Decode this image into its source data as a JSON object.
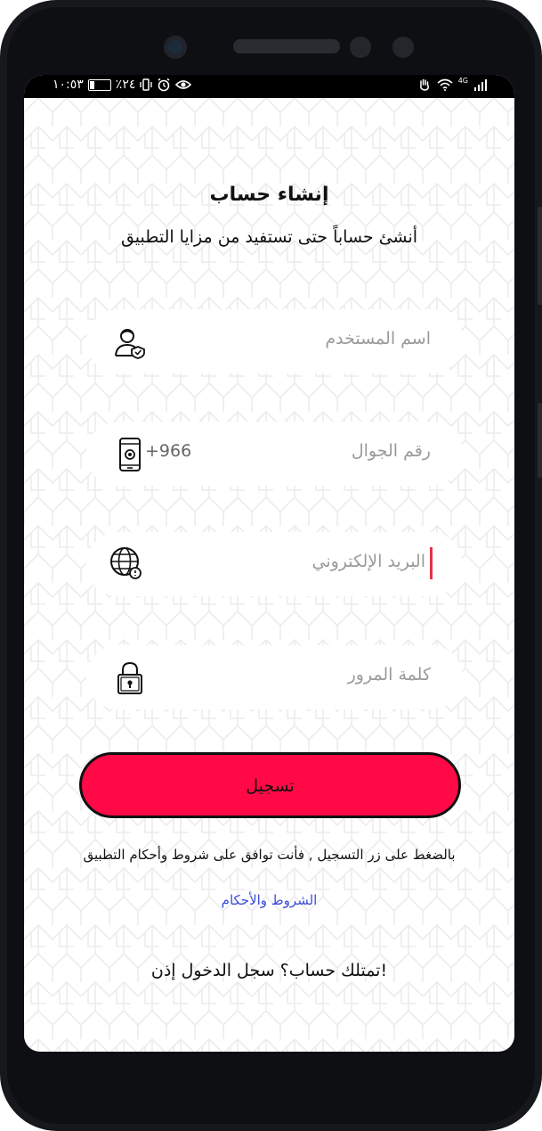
{
  "status_bar": {
    "time": "١٠:٥٣",
    "battery_percent_label": "٪٢٤",
    "battery_level": 0.24,
    "network_label": "4G",
    "icons": [
      "battery-icon",
      "vibrate-icon",
      "alarm-icon",
      "eye-icon",
      "hand-icon",
      "wifi-icon",
      "signal-icon"
    ]
  },
  "header": {
    "title": "إنشاء حساب",
    "subtitle": "أنشئ حساباً حتى تستفيد من مزايا التطبيق"
  },
  "form": {
    "username": {
      "placeholder": "اسم المستخدم",
      "icon": "user-shield-icon"
    },
    "phone": {
      "placeholder": "رقم الجوال",
      "prefix": "+966",
      "icon": "smartphone-icon"
    },
    "email": {
      "placeholder": "البريد الإلكتروني",
      "icon": "globe-icon",
      "focused": true
    },
    "password": {
      "placeholder": "كلمة المرور",
      "icon": "padlock-icon"
    }
  },
  "register_button": {
    "label": "تسجيل"
  },
  "terms": {
    "text": "بالضغط على زر التسجيل , فأنت توافق على شروط وأحكام التطبيق",
    "link_label": "الشروط والأحكام"
  },
  "login_prompt": {
    "label": "تمتلك حساب؟ سجل الدخول إذن!"
  },
  "colors": {
    "accent": "#ff0a46",
    "link": "#3c4bd8",
    "caret": "#e53148",
    "text": "#111111",
    "placeholder": "#9a9a9a"
  }
}
